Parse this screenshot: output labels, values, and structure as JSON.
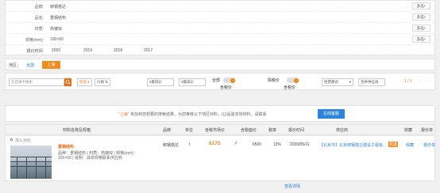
{
  "filters": {
    "rows": [
      {
        "label": "品牌:",
        "value": "柳钢搭达",
        "more": "多选+"
      },
      {
        "label": "品名:",
        "value": "重钢结构",
        "more": "多选+"
      },
      {
        "label": "材质:",
        "value": "热镀锌",
        "more": "多选+"
      },
      {
        "label": "规格(mm):",
        "value": "100×50",
        "more": "多选+"
      }
    ],
    "years_label": "报价时间:",
    "years": [
      "2020",
      "2019",
      "2018",
      "2017"
    ]
  },
  "region": {
    "label": "地区：",
    "all": "全国",
    "selected": "上海"
  },
  "toolbar": {
    "search_placeholder": "在结果中搜索",
    "sort_comprehensive": "综合",
    "sort_price": "价格",
    "price_min_placeholder": "¥最低价",
    "price_max_placeholder": "¥最高价",
    "all_label": "全部",
    "toggle1_label": "含税价",
    "tax_label": "除税价",
    "toggle2_label": "含税价",
    "mode": "经营模式",
    "merge": "合并供应商",
    "page": "1 / 1",
    "prev": "‹",
    "next": "›"
  },
  "notice": {
    "city": "\"上海\"",
    "text": "未找到您想要的搜索结果，为您推荐以下地区材料，(以后需本地材料，请联系",
    "button": "在线客服"
  },
  "table": {
    "headers": [
      "材料名称及规格",
      "品牌",
      "单位",
      "含税市场价",
      "含税面价",
      "税率",
      "报价时间",
      "供应商",
      "收藏",
      "报价单"
    ],
    "row": {
      "compare": "加入对比",
      "name": "重钢结构",
      "desc1": "品种：重钢结构 | 材质：热镀锌 | 规格(mm)：",
      "desc2": "100×50 | 说明：具体规格联系供应商",
      "brand": "柳钢搭达",
      "unit": "t",
      "price": "6175",
      "face_price": "6500",
      "tax": "13%",
      "date": "2020/05/11",
      "supplier": "【北京市】北京柳钢搭达建设工程有...",
      "badge": "优选",
      "fav": "收藏",
      "quote": "报价单"
    }
  },
  "more_link": "查看详情",
  "colors": {
    "accent": "#f08b1f",
    "link": "#2f7fd0",
    "price": "#f08b1f",
    "button": "#2e82d9"
  }
}
